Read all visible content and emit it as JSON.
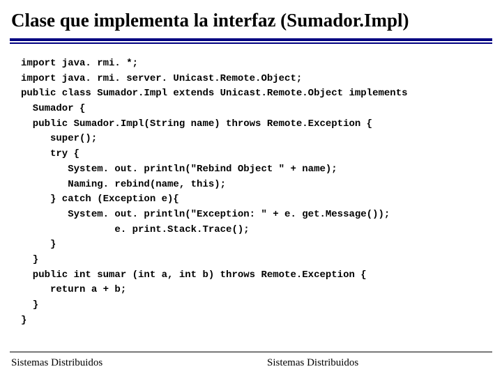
{
  "title": "Clase que implementa la interfaz (Sumador.Impl)",
  "code": "import java. rmi. *;\nimport java. rmi. server. Unicast.Remote.Object;\npublic class Sumador.Impl extends Unicast.Remote.Object implements\n  Sumador {\n  public Sumador.Impl(String name) throws Remote.Exception {\n     super();\n     try {\n        System. out. println(\"Rebind Object \" + name);\n        Naming. rebind(name, this);\n     } catch (Exception e){\n        System. out. println(\"Exception: \" + e. get.Message());\n                e. print.Stack.Trace();\n     }\n  }\n  public int sumar (int a, int b) throws Remote.Exception {\n     return a + b;\n  }\n}",
  "footer": {
    "left": "Sistemas Distribuidos",
    "right": "Sistemas Distribuidos"
  }
}
